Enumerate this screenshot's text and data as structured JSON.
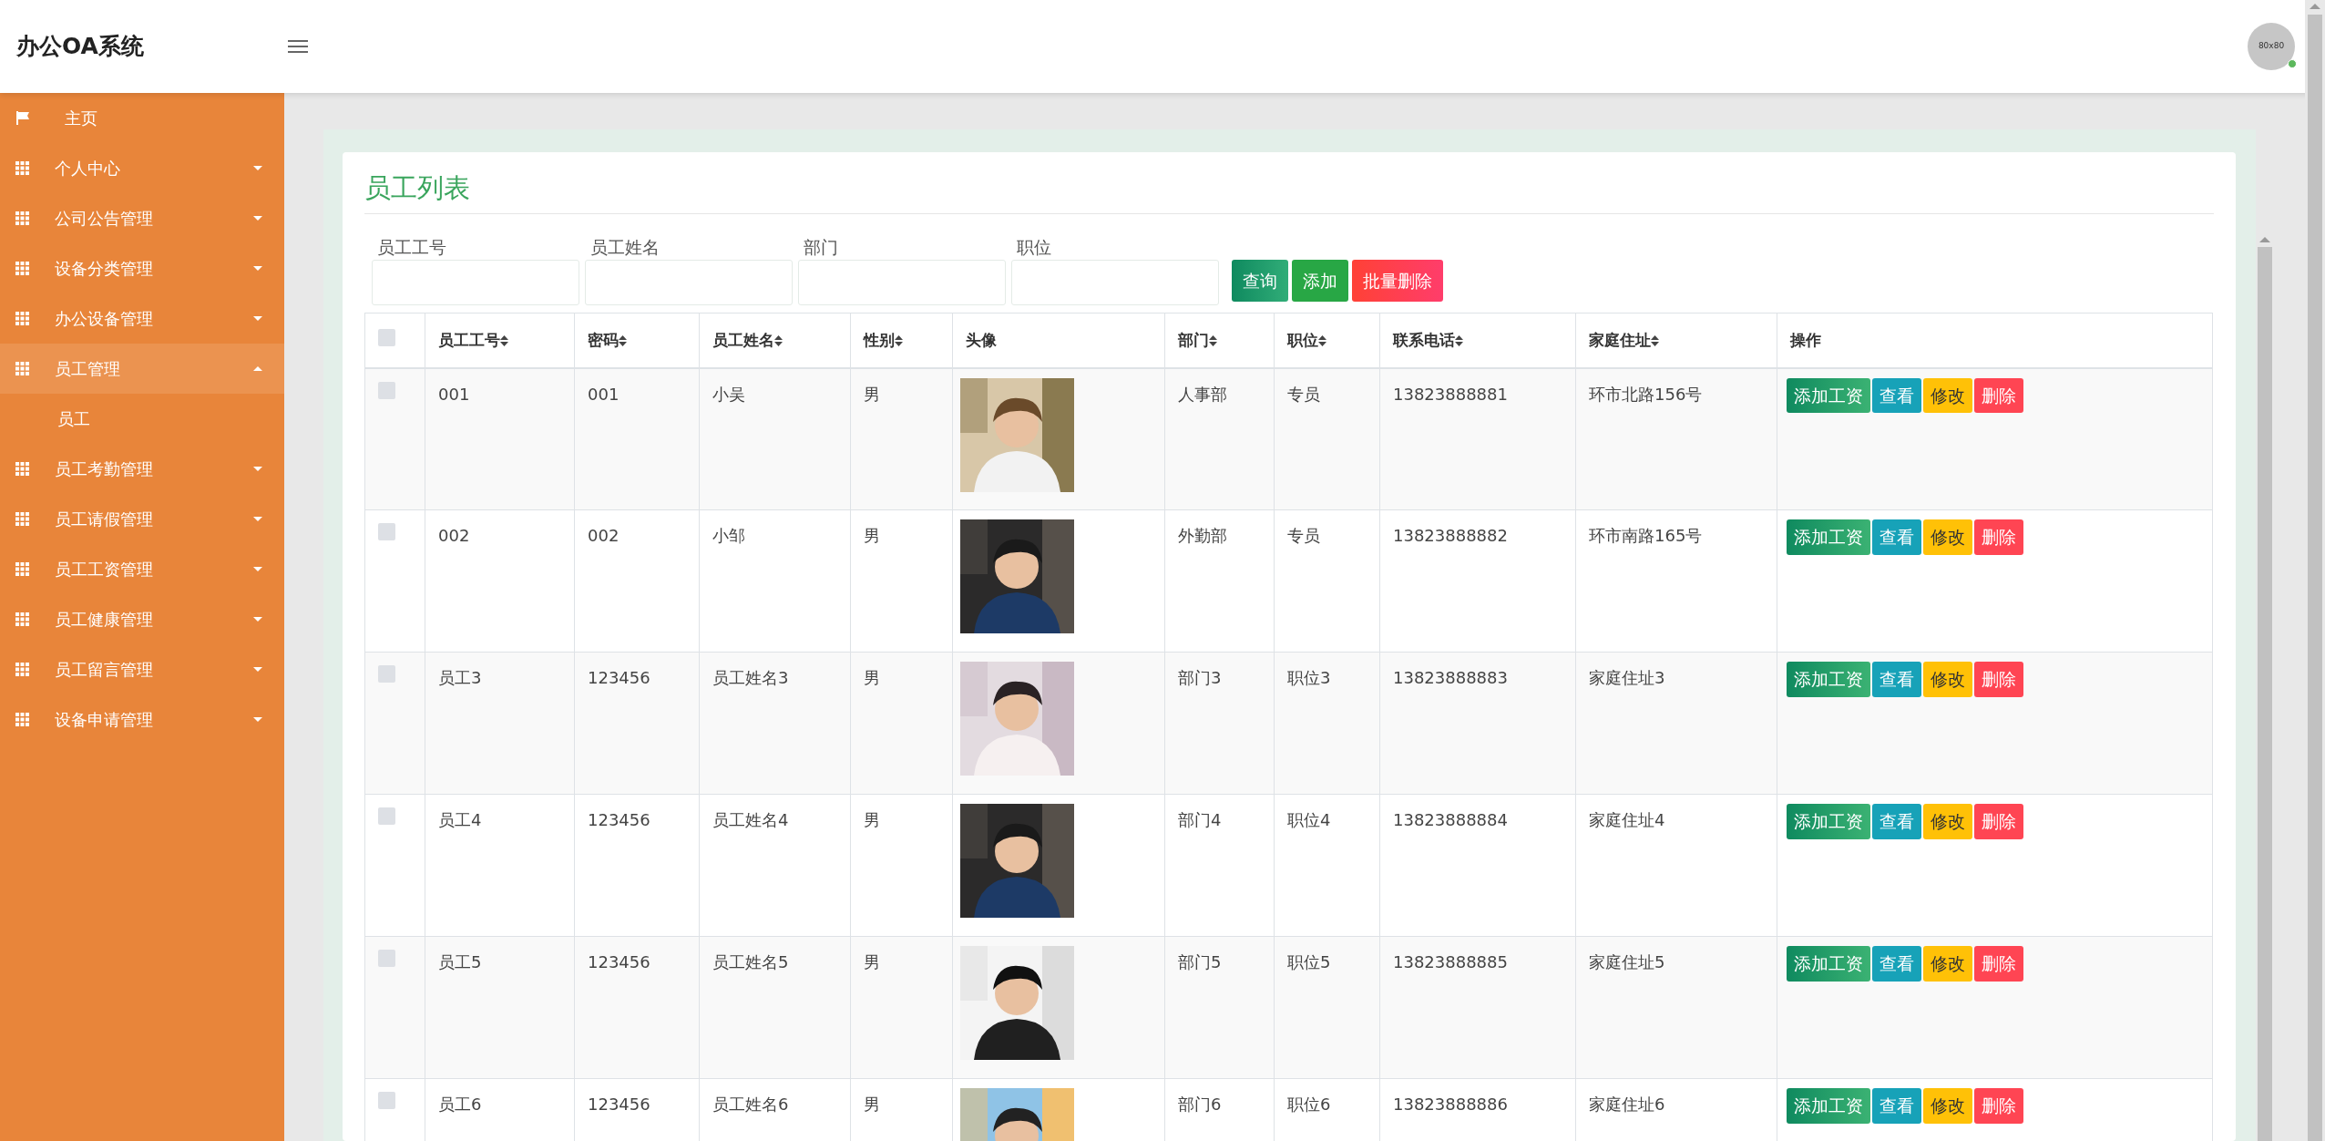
{
  "header": {
    "title": "办公OA系统",
    "avatar_text": "80x80",
    "online": true
  },
  "sidebar": {
    "items": [
      {
        "kind": "home",
        "label": "主页",
        "expanded": false
      },
      {
        "kind": "menu",
        "label": "个人中心",
        "expanded": false
      },
      {
        "kind": "menu",
        "label": "公司公告管理",
        "expanded": false
      },
      {
        "kind": "menu",
        "label": "设备分类管理",
        "expanded": false
      },
      {
        "kind": "menu",
        "label": "办公设备管理",
        "expanded": false
      },
      {
        "kind": "menu",
        "label": "员工管理",
        "expanded": true,
        "children": [
          {
            "label": "员工"
          }
        ]
      },
      {
        "kind": "menu",
        "label": "员工考勤管理",
        "expanded": false
      },
      {
        "kind": "menu",
        "label": "员工请假管理",
        "expanded": false
      },
      {
        "kind": "menu",
        "label": "员工工资管理",
        "expanded": false
      },
      {
        "kind": "menu",
        "label": "员工健康管理",
        "expanded": false
      },
      {
        "kind": "menu",
        "label": "员工留言管理",
        "expanded": false
      },
      {
        "kind": "menu",
        "label": "设备申请管理",
        "expanded": false
      }
    ]
  },
  "page_title": "员工列表",
  "search": {
    "fields": [
      {
        "label": "员工工号"
      },
      {
        "label": "员工姓名"
      },
      {
        "label": "部门"
      },
      {
        "label": "职位"
      }
    ],
    "buttons": [
      {
        "label": "查询",
        "kind": "search"
      },
      {
        "label": "添加",
        "kind": "add"
      },
      {
        "label": "批量删除",
        "kind": "delete"
      }
    ]
  },
  "table": {
    "select_all_checked": false,
    "columns": [
      {
        "label": "员工工号",
        "sortable": true
      },
      {
        "label": "密码",
        "sortable": true
      },
      {
        "label": "员工姓名",
        "sortable": true
      },
      {
        "label": "性别",
        "sortable": true
      },
      {
        "label": "头像",
        "sortable": false
      },
      {
        "label": "部门",
        "sortable": true
      },
      {
        "label": "职位",
        "sortable": true
      },
      {
        "label": "联系电话",
        "sortable": true
      },
      {
        "label": "家庭住址",
        "sortable": true
      },
      {
        "label": "操作",
        "sortable": false
      }
    ],
    "rows": [
      {
        "checked": false,
        "cells": [
          "001",
          "001",
          "小吴",
          "男",
          {
            "kind": "picture"
          },
          "人事部",
          "专员",
          "13823888881",
          "环市北路156号"
        ],
        "actions": [
          "添加工资",
          "查看",
          "修改",
          "删除"
        ]
      },
      {
        "checked": false,
        "cells": [
          "002",
          "002",
          "小邹",
          "男",
          {
            "kind": "picture"
          },
          "外勤部",
          "专员",
          "13823888882",
          "环市南路165号"
        ],
        "actions": [
          "添加工资",
          "查看",
          "修改",
          "删除"
        ]
      },
      {
        "checked": false,
        "cells": [
          "员工3",
          "123456",
          "员工姓名3",
          "男",
          {
            "kind": "picture"
          },
          "部门3",
          "职位3",
          "13823888883",
          "家庭住址3"
        ],
        "actions": [
          "添加工资",
          "查看",
          "修改",
          "删除"
        ]
      },
      {
        "checked": false,
        "cells": [
          "员工4",
          "123456",
          "员工姓名4",
          "男",
          {
            "kind": "picture"
          },
          "部门4",
          "职位4",
          "13823888884",
          "家庭住址4"
        ],
        "actions": [
          "添加工资",
          "查看",
          "修改",
          "删除"
        ]
      },
      {
        "checked": false,
        "cells": [
          "员工5",
          "123456",
          "员工姓名5",
          "男",
          {
            "kind": "picture"
          },
          "部门5",
          "职位5",
          "13823888885",
          "家庭住址5"
        ],
        "actions": [
          "添加工资",
          "查看",
          "修改",
          "删除"
        ]
      },
      {
        "checked": false,
        "cells": [
          "员工6",
          "123456",
          "员工姓名6",
          "男",
          {
            "kind": "picture"
          },
          "部门6",
          "职位6",
          "13823888886",
          "家庭住址6"
        ],
        "actions": [
          "添加工资",
          "查看",
          "修改",
          "删除"
        ]
      }
    ]
  }
}
